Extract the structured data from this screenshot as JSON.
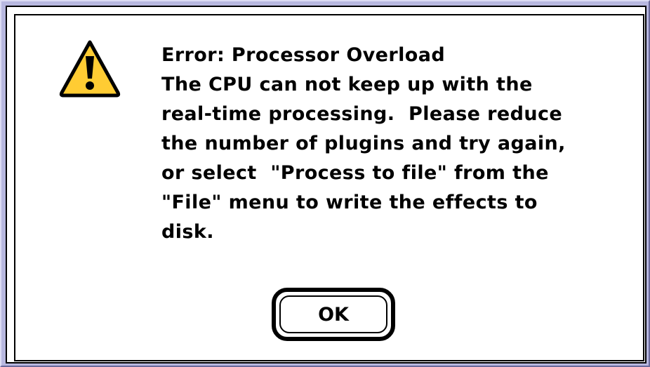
{
  "dialog": {
    "icon": "caution-icon",
    "title": "Error: Processor Overload",
    "message_lines": [
      "The CPU can not keep up with the",
      "real-time processing.  Please reduce",
      "the number of plugins and try again,",
      "or select  \"Process to file\" from the",
      "\"File\" menu to write the effects to",
      "disk."
    ],
    "ok_label": "OK"
  },
  "colors": {
    "desktop": "#9c9ccc",
    "icon_fill": "#ffcc33",
    "text": "#000000"
  }
}
